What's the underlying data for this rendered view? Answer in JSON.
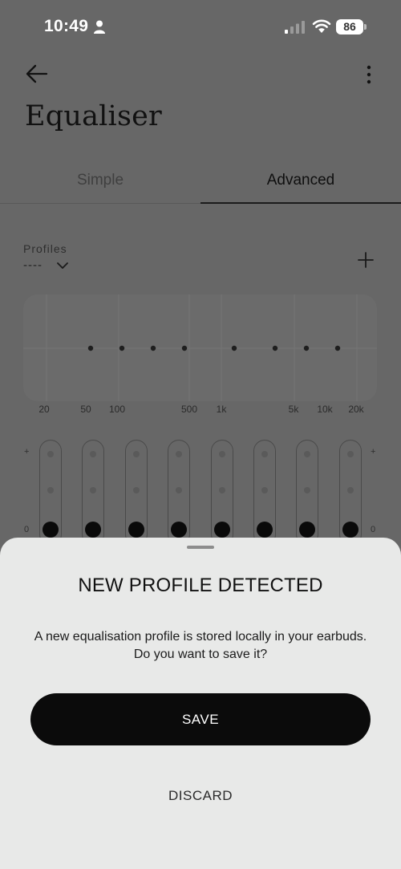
{
  "status_bar": {
    "time": "10:49",
    "battery": "86"
  },
  "header": {
    "title": "Equaliser"
  },
  "tabs": [
    {
      "label": "Simple",
      "selected": false
    },
    {
      "label": "Advanced",
      "selected": true
    }
  ],
  "profiles": {
    "label": "Profiles",
    "value": "----"
  },
  "frequency_labels": [
    "20",
    "50",
    "100",
    "500",
    "1k",
    "5k",
    "10k",
    "20k"
  ],
  "slider_marks": {
    "plus": "+",
    "zero": "0"
  },
  "sheet": {
    "title": "NEW PROFILE DETECTED",
    "message_line1": "A new equalisation profile is stored locally in your earbuds.",
    "message_line2": "Do you want to save it?",
    "save_label": "SAVE",
    "discard_label": "DISCARD"
  }
}
